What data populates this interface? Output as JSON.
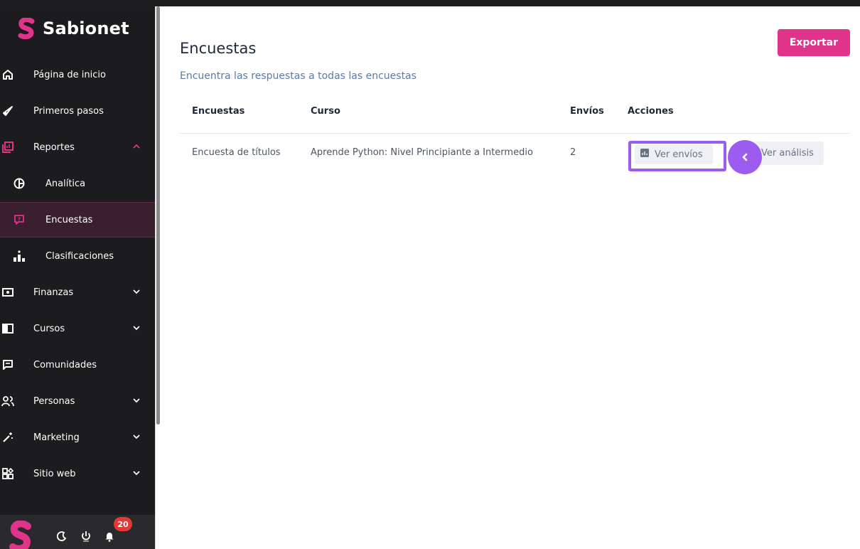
{
  "app": {
    "name": "Sabionet"
  },
  "sidebar": {
    "items": [
      {
        "label": "Página de inicio",
        "icon": "home-icon"
      },
      {
        "label": "Primeros pasos",
        "icon": "rocket-icon"
      },
      {
        "label": "Reportes",
        "icon": "report-icon",
        "expanded": true
      },
      {
        "label": "Analítica",
        "icon": "pie-chart-icon"
      },
      {
        "label": "Encuestas",
        "icon": "survey-icon",
        "active": true
      },
      {
        "label": "Clasificaciones",
        "icon": "podium-icon"
      },
      {
        "label": "Finanzas",
        "icon": "money-icon"
      },
      {
        "label": "Cursos",
        "icon": "book-icon"
      },
      {
        "label": "Comunidades",
        "icon": "chat-icon"
      },
      {
        "label": "Personas",
        "icon": "people-icon"
      },
      {
        "label": "Marketing",
        "icon": "magic-wand-icon"
      },
      {
        "label": "Sitio web",
        "icon": "apps-icon"
      }
    ],
    "footer": {
      "notifications_count": "20"
    }
  },
  "header": {
    "title": "Encuestas",
    "subtitle": "Encuentra las respuestas a todas las encuestas",
    "export_label": "Exportar"
  },
  "table": {
    "columns": [
      "Encuestas",
      "Curso",
      "Envíos",
      "Acciones"
    ],
    "rows": [
      {
        "survey": "Encuesta de títulos",
        "course": "Aprende Python: Nivel Principiante a Intermedio",
        "submissions": "2",
        "action_view": "Ver envíos",
        "action_analysis": "Ver análisis"
      }
    ]
  },
  "colors": {
    "brand": "#e0338a",
    "highlight": "#9d5cf0",
    "sidebar_bg": "#1c1c1e"
  }
}
